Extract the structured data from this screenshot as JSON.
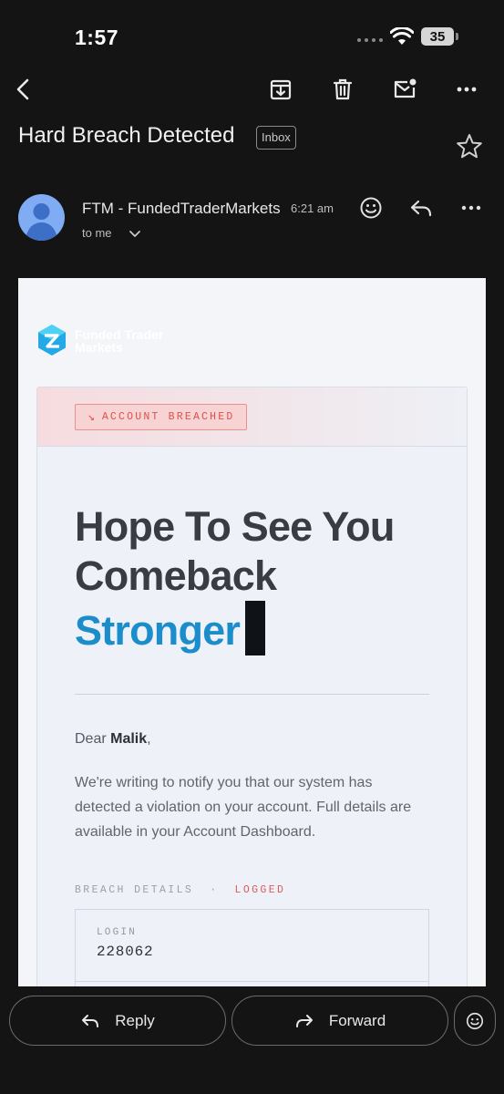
{
  "status_bar": {
    "time": "1:57",
    "battery": "35"
  },
  "email": {
    "subject": "Hard Breach Detected",
    "label": "Inbox",
    "sender": "FTM - FundedTraderMarkets",
    "time": "6:21 am",
    "recipient": "to me"
  },
  "body": {
    "brand_line1": "Funded Trader",
    "brand_line2": "Markets",
    "badge": "ACCOUNT BREACHED",
    "headline_line1": "Hope To See You",
    "headline_line2": "Comeback",
    "headline_accent": "Stronger",
    "greeting_prefix": "Dear ",
    "recipient_name": "Malik",
    "greeting_suffix": ",",
    "paragraph": "We're writing to notify you that our system has detected a violation on your account. Full details are available in your Account Dashboard.",
    "details_label": "BREACH DETAILS",
    "details_sep": "·",
    "details_status": "LOGGED",
    "login_label": "LOGIN",
    "login_value": "228062"
  },
  "actions": {
    "reply": "Reply",
    "forward": "Forward"
  },
  "colors": {
    "accent": "#1c8dcb",
    "breach": "#d9534f",
    "dark_bg": "#141414"
  },
  "icons": [
    "back-icon",
    "archive-icon",
    "delete-icon",
    "mark-unread-icon",
    "more-icon",
    "star-icon",
    "emoji-icon",
    "reply-icon",
    "forward-icon"
  ]
}
